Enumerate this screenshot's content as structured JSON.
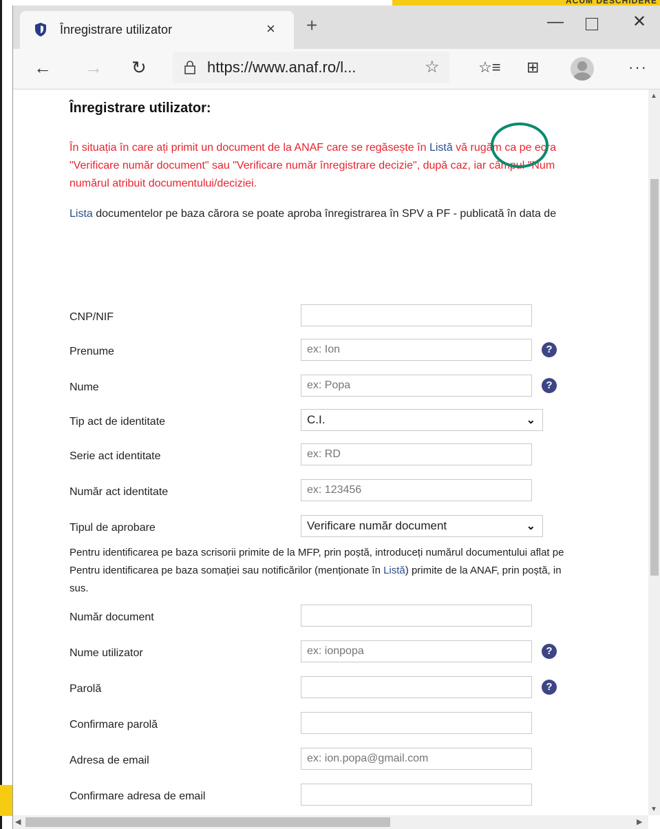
{
  "banner": {
    "text": "ACUM DESCHIDERE"
  },
  "browser": {
    "tab_title": "Înregistrare utilizator",
    "tab_close": "×",
    "new_tab": "+",
    "url": "https://www.anaf.ro/l...",
    "minimize": "—",
    "close": "✕",
    "back": "←",
    "forward": "→",
    "refresh": "↻",
    "star": "☆",
    "favorites": "☆≡",
    "collections": "⊞",
    "more": "···"
  },
  "page": {
    "heading": "Înregistrare utilizator:",
    "notice": {
      "line1_before": "În situația în care ați primit un document de la ANAF care se regăsește în ",
      "line1_link": "Listă",
      "line1_after": " vă rugăm ca pe ecra",
      "line2": "\"Verificare număr document\" sau \"Verificare număr înregistrare decizie\", după caz, iar câmpul \"Num",
      "line3": "numărul atribuit documentului/deciziei."
    },
    "list_line": {
      "link": "Lista",
      "text": " documentelor pe baza cărora se poate aproba înregistrarea în SPV a PF - publicată în data de"
    },
    "info": {
      "line1": "Pentru identificarea pe baza scrisorii primite de la MFP, prin poștă, introduceți numărul documentului aflat pe",
      "line2_before": "Pentru identificarea pe baza somației sau notificărilor (menționate în ",
      "line2_link": "Listă",
      "line2_after": ") primite de la ANAF, prin poștă, in",
      "line3": "sus."
    }
  },
  "form": {
    "cnp": {
      "label": "CNP/NIF",
      "value": "",
      "placeholder": ""
    },
    "prenume": {
      "label": "Prenume",
      "placeholder": "ex: Ion"
    },
    "nume": {
      "label": "Nume",
      "placeholder": "ex: Popa"
    },
    "tip_act": {
      "label": "Tip act de identitate",
      "value": "C.I."
    },
    "serie": {
      "label": "Serie act identitate",
      "placeholder": "ex: RD"
    },
    "numar_act": {
      "label": "Număr act identitate",
      "placeholder": "ex: 123456"
    },
    "tip_aprobare": {
      "label": "Tipul de aprobare",
      "value": "Verificare număr document"
    },
    "numar_document": {
      "label": "Număr document",
      "placeholder": ""
    },
    "nume_utilizator": {
      "label": "Nume utilizator",
      "placeholder": "ex: ionpopa"
    },
    "parola": {
      "label": "Parolă",
      "placeholder": ""
    },
    "confirmare_parola": {
      "label": "Confirmare parolă",
      "placeholder": ""
    },
    "email": {
      "label": "Adresa de email",
      "placeholder": "ex: ion.popa@gmail.com"
    },
    "confirmare_email": {
      "label": "Confirmare adresa de email",
      "placeholder": ""
    },
    "help_symbol": "?",
    "chevron": "⌄"
  },
  "colors": {
    "notice_red": "#e8232f",
    "link_blue": "#2a4d8f",
    "help_bg": "#3e4585",
    "annotation_circle": "#0c8a6d"
  }
}
